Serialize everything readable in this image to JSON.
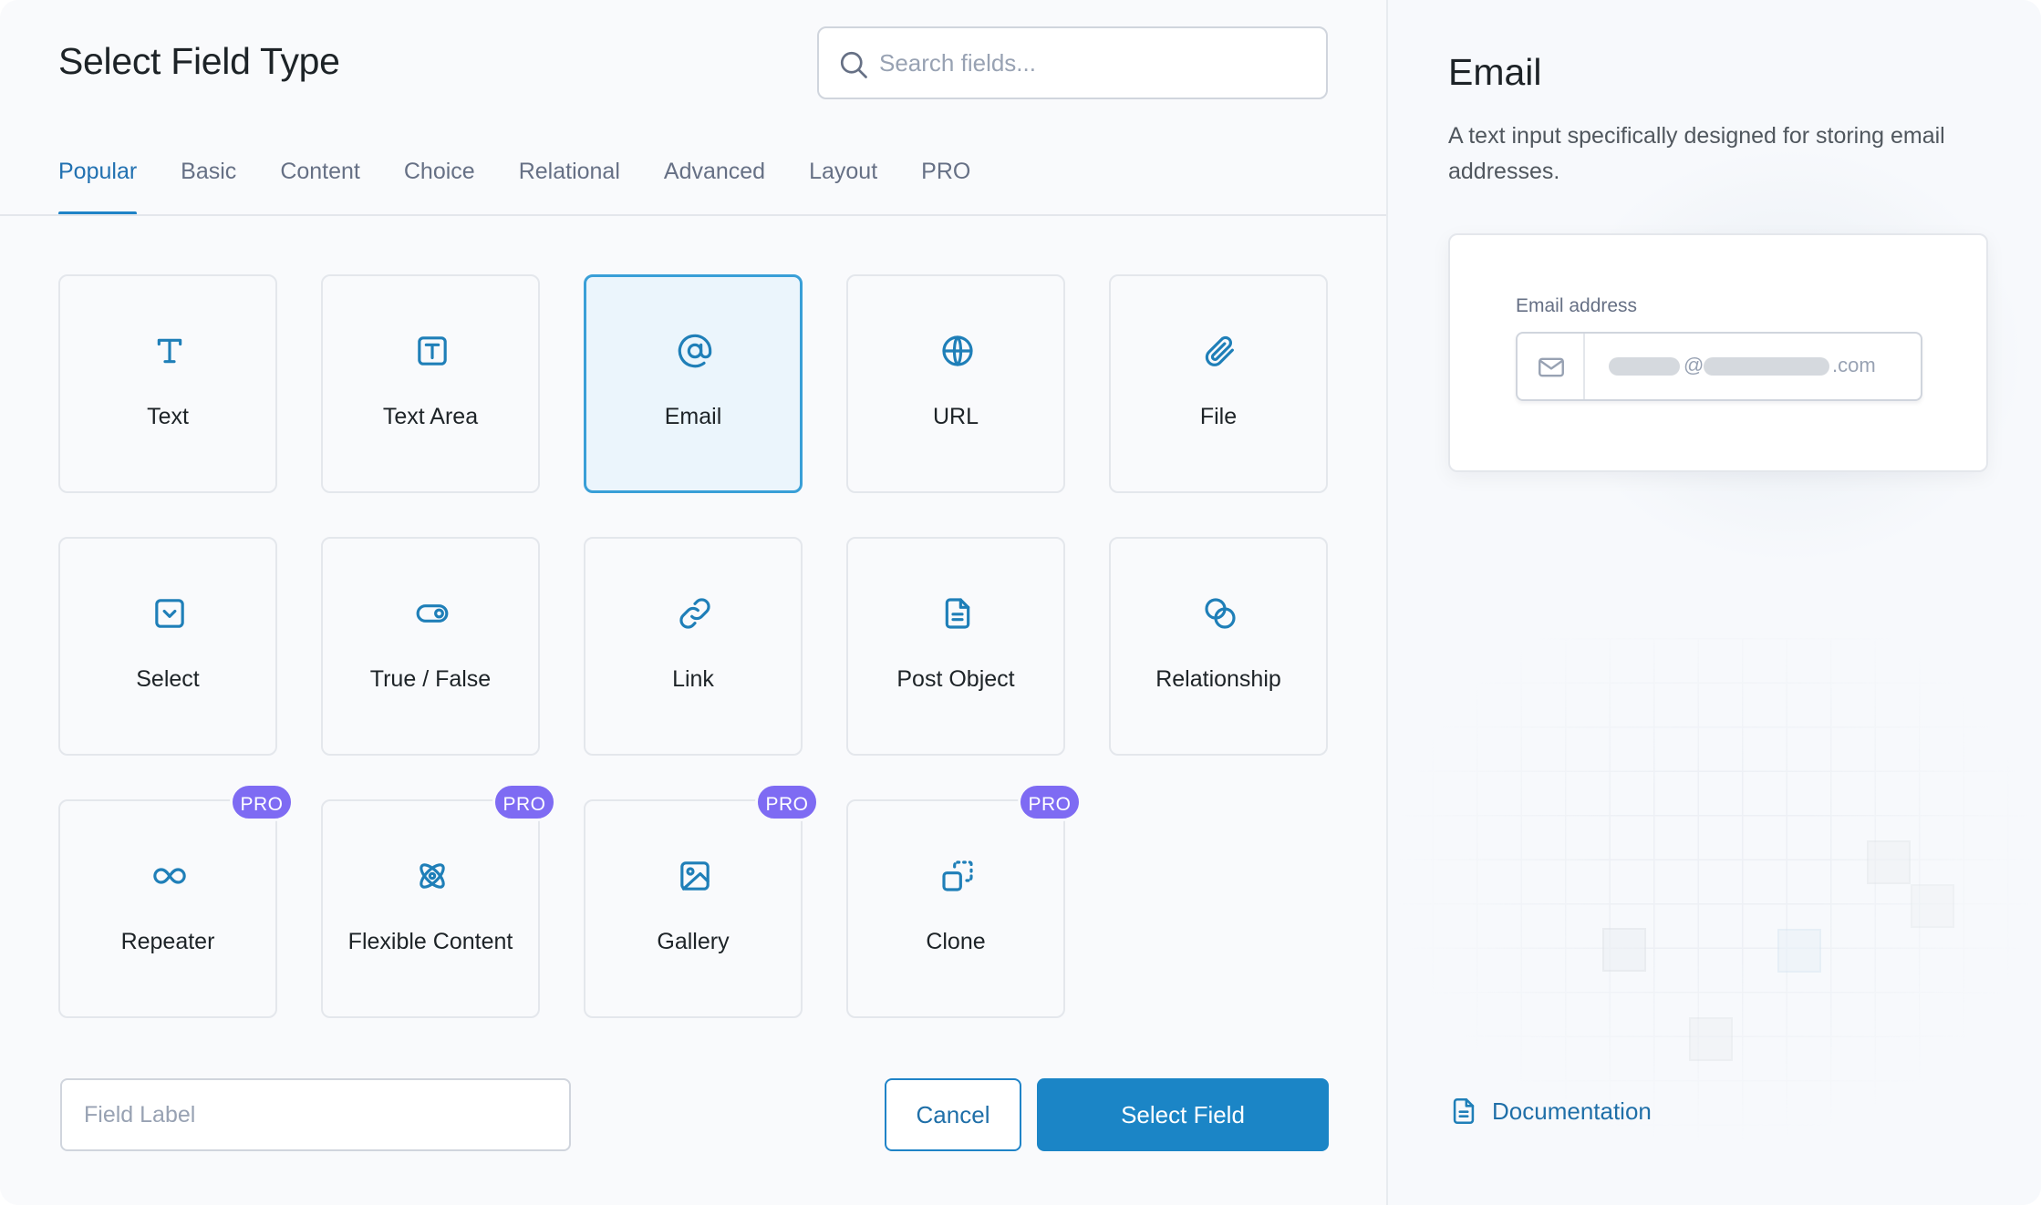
{
  "header": {
    "title": "Select Field Type",
    "search_placeholder": "Search fields..."
  },
  "tabs": [
    {
      "label": "Popular",
      "active": true
    },
    {
      "label": "Basic",
      "active": false
    },
    {
      "label": "Content",
      "active": false
    },
    {
      "label": "Choice",
      "active": false
    },
    {
      "label": "Relational",
      "active": false
    },
    {
      "label": "Advanced",
      "active": false
    },
    {
      "label": "Layout",
      "active": false
    },
    {
      "label": "PRO",
      "active": false
    }
  ],
  "fields": [
    {
      "label": "Text",
      "icon": "text-icon",
      "selected": false,
      "pro": false
    },
    {
      "label": "Text Area",
      "icon": "textarea-icon",
      "selected": false,
      "pro": false
    },
    {
      "label": "Email",
      "icon": "at-icon",
      "selected": true,
      "pro": false
    },
    {
      "label": "URL",
      "icon": "globe-icon",
      "selected": false,
      "pro": false
    },
    {
      "label": "File",
      "icon": "paperclip-icon",
      "selected": false,
      "pro": false
    },
    {
      "label": "Select",
      "icon": "select-icon",
      "selected": false,
      "pro": false
    },
    {
      "label": "True / False",
      "icon": "toggle-icon",
      "selected": false,
      "pro": false
    },
    {
      "label": "Link",
      "icon": "link-icon",
      "selected": false,
      "pro": false
    },
    {
      "label": "Post Object",
      "icon": "document-icon",
      "selected": false,
      "pro": false
    },
    {
      "label": "Relationship",
      "icon": "relationship-icon",
      "selected": false,
      "pro": false
    },
    {
      "label": "Repeater",
      "icon": "infinity-icon",
      "selected": false,
      "pro": true
    },
    {
      "label": "Flexible Content",
      "icon": "atom-icon",
      "selected": false,
      "pro": true
    },
    {
      "label": "Gallery",
      "icon": "image-icon",
      "selected": false,
      "pro": true
    },
    {
      "label": "Clone",
      "icon": "clone-icon",
      "selected": false,
      "pro": true
    }
  ],
  "pro_badge_label": "PRO",
  "footer": {
    "field_label_placeholder": "Field Label",
    "cancel_label": "Cancel",
    "select_label": "Select Field"
  },
  "preview": {
    "title": "Email",
    "description": "A text input specifically designed for storing email addresses.",
    "field_label": "Email address",
    "at_symbol": "@",
    "domain_suffix": ".com",
    "documentation_label": "Documentation"
  },
  "colors": {
    "accent": "#1b85c6",
    "tab_active": "#2271b1",
    "selected_card_bg": "#ebf5fc",
    "selected_card_border": "#399fd7",
    "pro_badge": "#7e6bf3",
    "icon": "#1f7fb8"
  }
}
